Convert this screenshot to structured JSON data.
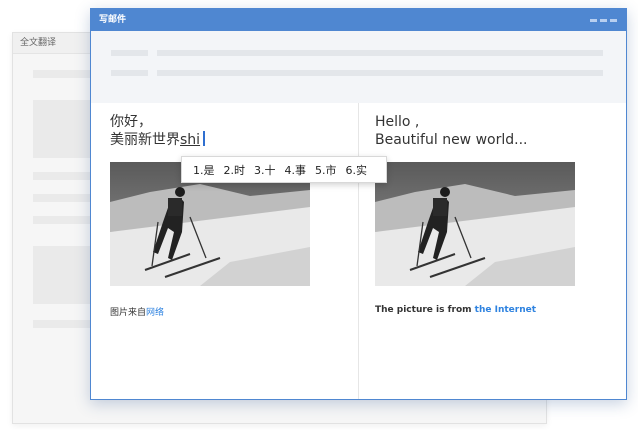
{
  "background_window": {
    "title": "全文翻译"
  },
  "compose_window": {
    "title": "写邮件",
    "source": {
      "line1": "你好，",
      "line2_prefix": "美丽新世界",
      "line2_pinyin": "shi",
      "caption_text": "图片来自",
      "caption_link": "网络"
    },
    "translation": {
      "line1": "Hello ,",
      "line2": "Beautiful new world...",
      "caption_text": "The picture is from ",
      "caption_link": "the Internet"
    }
  },
  "ime_candidates": [
    "1.是",
    "2.时",
    "3.十",
    "4.事",
    "5.市",
    "6.实"
  ],
  "colors": {
    "accent": "#4f87d1",
    "link": "#2f83e0",
    "caret": "#2f6fd0"
  }
}
